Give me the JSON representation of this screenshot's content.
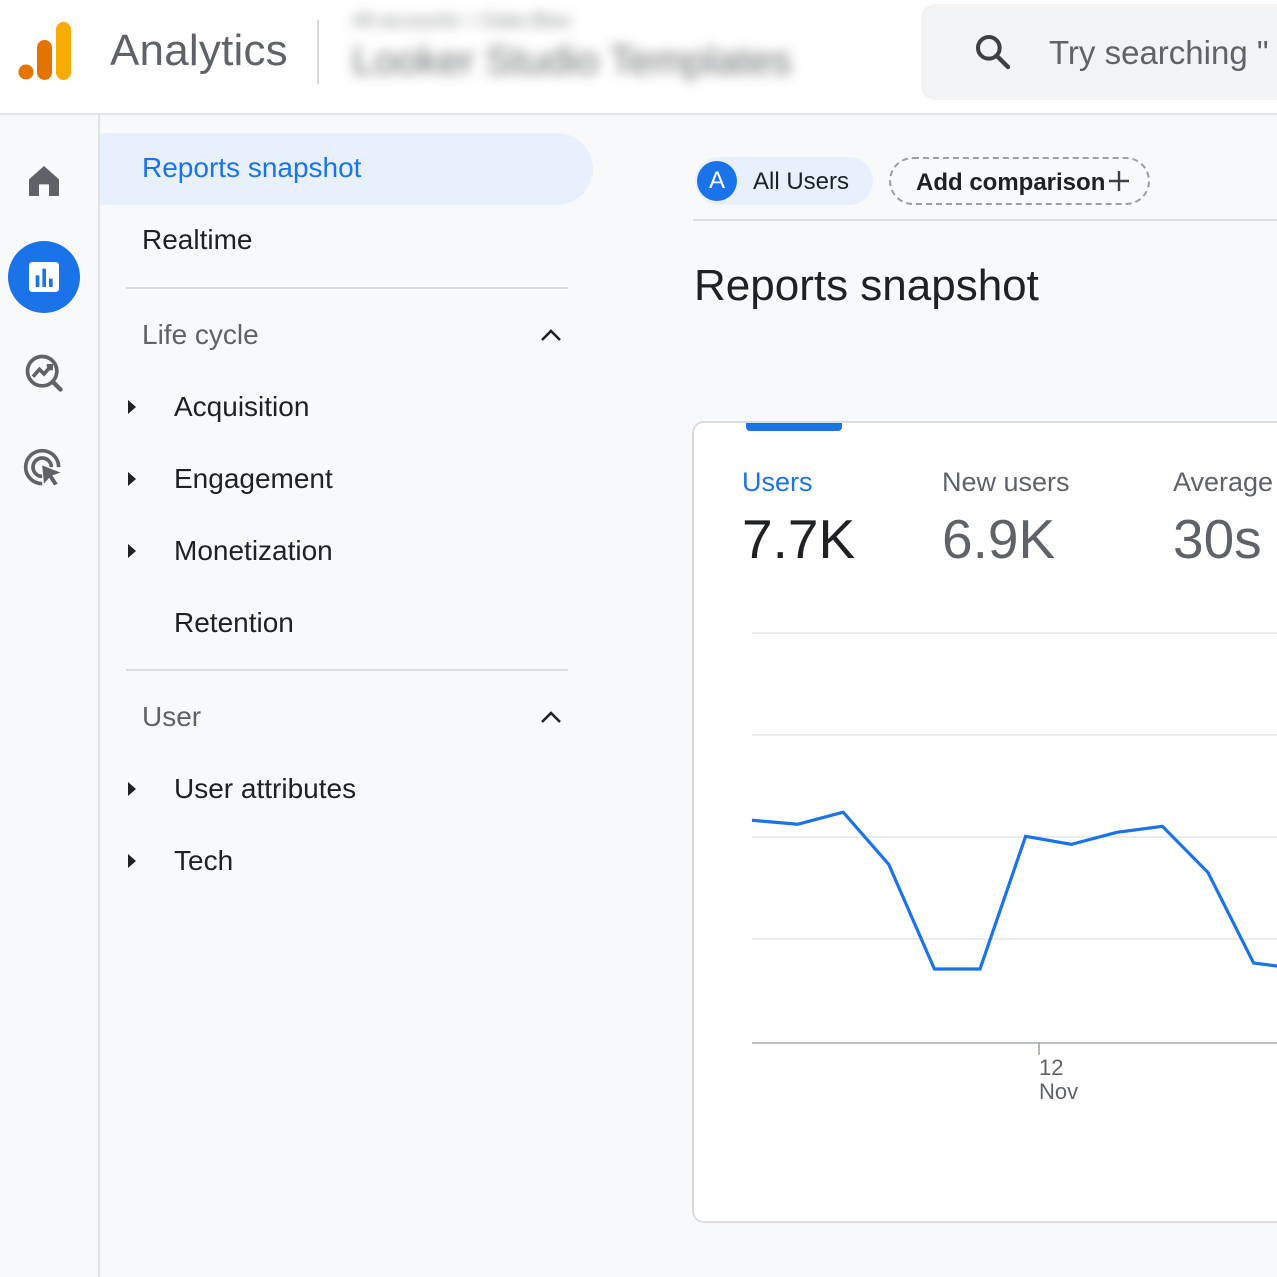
{
  "header": {
    "app_name": "Analytics",
    "account_path": "All accounts > Data Bloo",
    "property_name": "Looker Studio Templates",
    "search_placeholder": "Try searching \""
  },
  "rail": {
    "items": [
      {
        "name": "home-icon",
        "active": false
      },
      {
        "name": "reports-icon",
        "active": true
      },
      {
        "name": "explore-icon",
        "active": false
      },
      {
        "name": "advertising-icon",
        "active": false
      }
    ]
  },
  "nav": {
    "active_item": "Reports snapshot",
    "realtime": "Realtime",
    "sections": [
      {
        "title": "Life cycle",
        "items": [
          {
            "label": "Acquisition",
            "expandable": true
          },
          {
            "label": "Engagement",
            "expandable": true
          },
          {
            "label": "Monetization",
            "expandable": true
          },
          {
            "label": "Retention",
            "expandable": false
          }
        ]
      },
      {
        "title": "User",
        "items": [
          {
            "label": "User attributes",
            "expandable": true
          },
          {
            "label": "Tech",
            "expandable": true
          }
        ]
      }
    ]
  },
  "main": {
    "comparison_chip": {
      "avatar": "A",
      "label": "All Users"
    },
    "add_comparison": "Add comparison",
    "title": "Reports snapshot",
    "metrics": [
      {
        "label": "Users",
        "value": "7.7K",
        "selected": true
      },
      {
        "label": "New users",
        "value": "6.9K",
        "selected": false
      },
      {
        "label": "Average",
        "value": "30s",
        "selected": false
      }
    ]
  },
  "colors": {
    "accent": "#1a73e8",
    "logo_orange_dark": "#e37400",
    "logo_orange_light": "#f9ab00"
  },
  "chart_data": {
    "type": "line",
    "series": [
      {
        "values": [
          0.74,
          0.72,
          0.78,
          0.52,
          0.0,
          0.0,
          0.66,
          0.62,
          0.68,
          0.71,
          0.48,
          0.03,
          0.0
        ]
      }
    ],
    "ylim": [
      0,
      1
    ],
    "x_ticks": [
      {
        "index": 5,
        "label_day": "12",
        "label_month": "Nov"
      }
    ],
    "grid": true
  }
}
